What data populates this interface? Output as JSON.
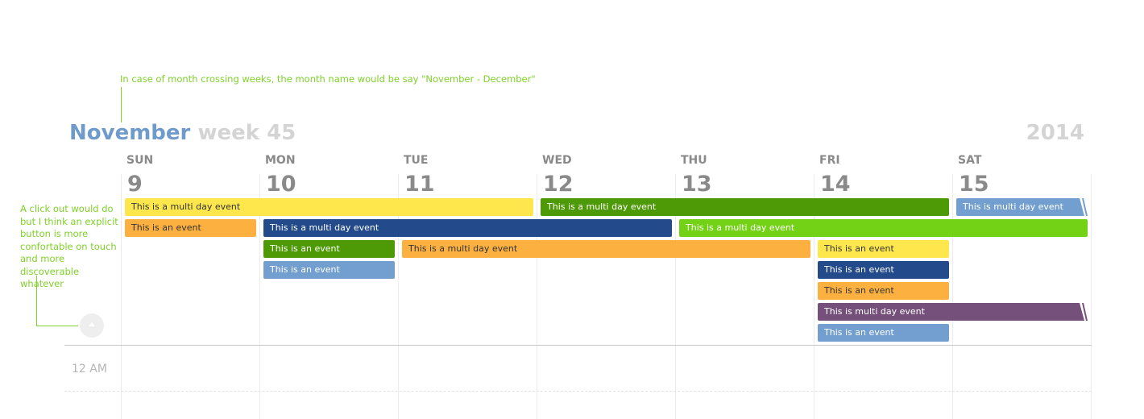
{
  "annotations": {
    "top": "In case of month crossing weeks, the month name would be say \"November - December\"",
    "left": "A click out would do but I think an explicit button is more confortable on touch and more discoverable whatever"
  },
  "header": {
    "month": "November",
    "week": "week 45",
    "year": "2014"
  },
  "days": [
    {
      "name": "SUN",
      "num": "9"
    },
    {
      "name": "MON",
      "num": "10"
    },
    {
      "name": "TUE",
      "num": "11"
    },
    {
      "name": "WED",
      "num": "12"
    },
    {
      "name": "THU",
      "num": "13"
    },
    {
      "name": "FRI",
      "num": "14"
    },
    {
      "name": "SAT",
      "num": "15"
    }
  ],
  "events": [
    {
      "label": "This is a multi day event",
      "color": "#fde74c",
      "text_color": "#333333",
      "start_day": "SUN",
      "end_day": "TUE",
      "continues": false
    },
    {
      "label": "This is an event",
      "color": "#fbb040",
      "text_color": "#333333",
      "start_day": "SUN",
      "end_day": "SUN",
      "continues": false
    },
    {
      "label": "This is a multi day event",
      "color": "#234a8a",
      "text_color": "#ffffff",
      "start_day": "MON",
      "end_day": "WED",
      "continues": false
    },
    {
      "label": "This is an event",
      "color": "#4e9a06",
      "text_color": "#ffffff",
      "start_day": "MON",
      "end_day": "MON",
      "continues": false
    },
    {
      "label": "This is an event",
      "color": "#729fcf",
      "text_color": "#ffffff",
      "start_day": "MON",
      "end_day": "MON",
      "continues": false
    },
    {
      "label": "This is a multi day event",
      "color": "#fbb040",
      "text_color": "#333333",
      "start_day": "TUE",
      "end_day": "THU",
      "continues": false
    },
    {
      "label": "This is a multi day event",
      "color": "#4e9a06",
      "text_color": "#ffffff",
      "start_day": "WED",
      "end_day": "FRI",
      "continues": false
    },
    {
      "label": "This is a multi day event",
      "color": "#73d216",
      "text_color": "#ffffff",
      "start_day": "THU",
      "end_day": "SAT",
      "continues": false
    },
    {
      "label": "This is an event",
      "color": "#fde74c",
      "text_color": "#333333",
      "start_day": "FRI",
      "end_day": "FRI",
      "continues": false
    },
    {
      "label": "This is an event",
      "color": "#234a8a",
      "text_color": "#ffffff",
      "start_day": "FRI",
      "end_day": "FRI",
      "continues": false
    },
    {
      "label": "This is an event",
      "color": "#fbb040",
      "text_color": "#333333",
      "start_day": "FRI",
      "end_day": "FRI",
      "continues": false
    },
    {
      "label": "This is multi day event",
      "color": "#75507b",
      "text_color": "#ffffff",
      "start_day": "FRI",
      "end_day": "SAT",
      "continues": true
    },
    {
      "label": "This is an event",
      "color": "#729fcf",
      "text_color": "#ffffff",
      "start_day": "FRI",
      "end_day": "FRI",
      "continues": false
    },
    {
      "label": "This is multi day event",
      "color": "#729fcf",
      "text_color": "#ffffff",
      "start_day": "SAT",
      "end_day": "SAT",
      "continues": true
    }
  ],
  "timeline": {
    "first_hour": "12 AM"
  }
}
